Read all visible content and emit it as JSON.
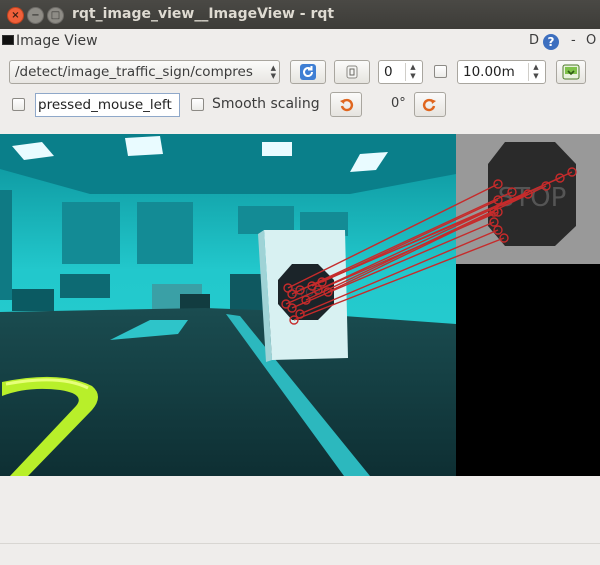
{
  "window": {
    "title": "rqt_image_view__ImageView - rqt",
    "close_glyph": "×",
    "minimize_glyph": "−",
    "maximize_glyph": "□"
  },
  "plugin": {
    "title": "Image View",
    "d_label": "D",
    "help_glyph": "?",
    "minimize_glyph": "-",
    "close_glyph": "O"
  },
  "toolbar": {
    "topic": "/detect/image_traffic_sign/compressed",
    "topic_visible": "/detect/image_traffic_sign/compres",
    "refresh_icon": "refresh-icon",
    "spin_value": "0",
    "spin_checked": false,
    "max_range": "10.00m",
    "save_icon": "save-icon"
  },
  "options": {
    "mouse_topic_checked": false,
    "mouse_topic": "pressed_mouse_left",
    "smooth_scaling_checked": false,
    "smooth_scaling_label": "Smooth scaling",
    "rotation": "0°"
  },
  "image": {
    "sign_text": "STOP",
    "colors": {
      "teal": "#20c6c8",
      "dark_floor": "#14393c",
      "match_lines": "#c62b2b",
      "lane_yellow": "#b8ef2a"
    }
  }
}
